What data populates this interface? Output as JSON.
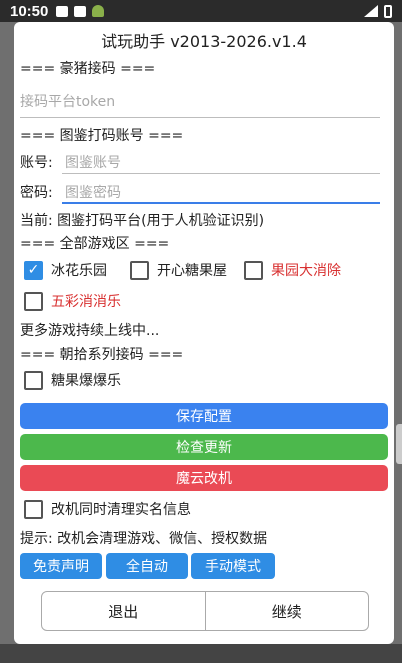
{
  "status": {
    "time": "10:50"
  },
  "title": "试玩助手 v2013-2026.v1.4",
  "haozhu": {
    "header": "=== 豪猪接码 ===",
    "token_placeholder": "接码平台token"
  },
  "tujian": {
    "header": "=== 图鉴打码账号 ===",
    "account_label": "账号:",
    "account_placeholder": "图鉴账号",
    "password_label": "密码:",
    "password_placeholder": "图鉴密码",
    "current": "当前: 图鉴打码平台(用于人机验证识别)"
  },
  "games": {
    "header": "=== 全部游戏区 ===",
    "items": [
      {
        "label": "冰花乐园",
        "checked": true
      },
      {
        "label": "开心糖果屋",
        "checked": false
      },
      {
        "label": "果园大消除",
        "checked": false
      },
      {
        "label": "五彩消消乐",
        "checked": false
      }
    ],
    "more": "更多游戏持续上线中..."
  },
  "chaoshi": {
    "header": "=== 朝拾系列接码 ===",
    "items": [
      {
        "label": "糖果爆爆乐",
        "checked": false
      }
    ]
  },
  "buttons": {
    "save": "保存配置",
    "check_update": "检查更新",
    "mofang": "魔云改机"
  },
  "colors": {
    "blue": "#3a82ef",
    "green": "#4cb84c",
    "red": "#ea4a55",
    "small_blue": "#2f8de4"
  },
  "clean_option": {
    "label": "改机同时清理实名信息",
    "checked": false
  },
  "tip": "提示: 改机会清理游戏、微信、授权数据",
  "small_buttons": {
    "disclaimer": "免责声明",
    "auto": "全自动",
    "manual": "手动模式"
  },
  "footer": {
    "exit": "退出",
    "continue": "继续"
  }
}
